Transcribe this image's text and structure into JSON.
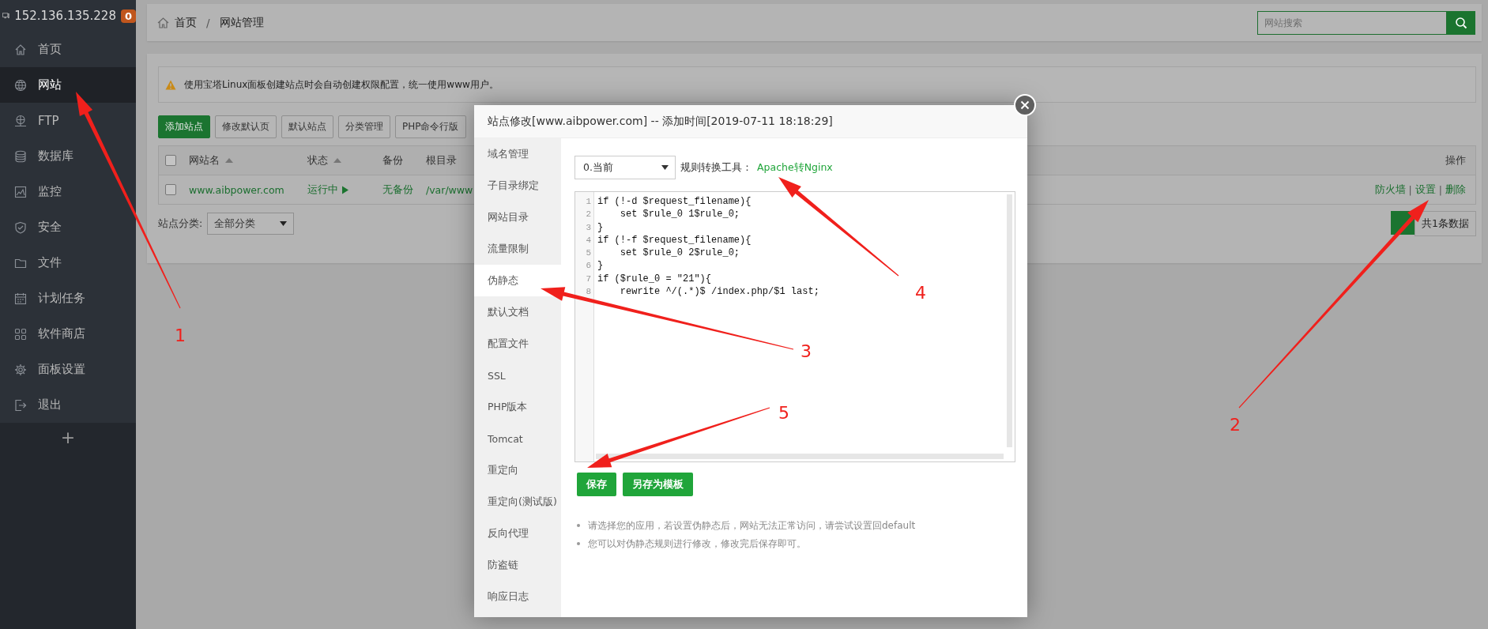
{
  "server": {
    "ip": "152.136.135.228",
    "badge": "0"
  },
  "sidebar": {
    "items": [
      {
        "label": "首页",
        "selected": false
      },
      {
        "label": "网站",
        "selected": true
      },
      {
        "label": "FTP",
        "selected": false
      },
      {
        "label": "数据库",
        "selected": false
      },
      {
        "label": "监控",
        "selected": false
      },
      {
        "label": "安全",
        "selected": false
      },
      {
        "label": "文件",
        "selected": false
      },
      {
        "label": "计划任务",
        "selected": false
      },
      {
        "label": "软件商店",
        "selected": false
      },
      {
        "label": "面板设置",
        "selected": false
      },
      {
        "label": "退出",
        "selected": false
      }
    ],
    "add": "+"
  },
  "breadcrumb": [
    "首页",
    "网站管理"
  ],
  "breadcrumb_separator": "/",
  "search": {
    "placeholder": "网站搜索"
  },
  "alert": "使用宝塔Linux面板创建站点时会自动创建权限配置，统一使用www用户。",
  "toolbar": [
    {
      "label": "添加站点",
      "kind": "primary"
    },
    {
      "label": "修改默认页",
      "kind": "default"
    },
    {
      "label": "默认站点",
      "kind": "default"
    },
    {
      "label": "分类管理",
      "kind": "default"
    },
    {
      "label": "PHP命令行版",
      "kind": "default"
    }
  ],
  "table": {
    "header_checked": false,
    "columns": [
      {
        "label": "网站名",
        "sortable": true
      },
      {
        "label": "状态",
        "sortable": true
      },
      {
        "label": "备份",
        "sortable": false
      },
      {
        "label": "根目录",
        "sortable": false
      },
      {
        "label": "操作",
        "sortable": false
      }
    ],
    "rows": [
      {
        "checked": false,
        "name": "www.aibpower.com",
        "status": "运行中",
        "backup": "无备份",
        "path": "/var/www",
        "actions": [
          "防火墙",
          "设置",
          "删除"
        ],
        "action_separators": [
          "|",
          "|"
        ]
      }
    ]
  },
  "category": {
    "label": "站点分类:",
    "value": "全部分类"
  },
  "pagination": {
    "total": "共1条数据"
  },
  "modal": {
    "title": "站点修改[www.aibpower.com] -- 添加时间[2019-07-11 18:18:29]",
    "tabs": [
      {
        "label": "域名管理",
        "selected": false
      },
      {
        "label": "子目录绑定",
        "selected": false
      },
      {
        "label": "网站目录",
        "selected": false
      },
      {
        "label": "流量限制",
        "selected": false
      },
      {
        "label": "伪静态",
        "selected": true
      },
      {
        "label": "默认文档",
        "selected": false
      },
      {
        "label": "配置文件",
        "selected": false
      },
      {
        "label": "SSL",
        "selected": false
      },
      {
        "label": "PHP版本",
        "selected": false
      },
      {
        "label": "Tomcat",
        "selected": false
      },
      {
        "label": "重定向",
        "selected": false
      },
      {
        "label": "重定向(测试版)",
        "selected": false
      },
      {
        "label": "反向代理",
        "selected": false
      },
      {
        "label": "防盗链",
        "selected": false
      },
      {
        "label": "响应日志",
        "selected": false
      }
    ],
    "rule_select": "0.当前",
    "tool_label": "规则转换工具：",
    "tool_link": "Apache转Nginx",
    "code": [
      {
        "n": "1",
        "text": "if (!-d $request_filename){"
      },
      {
        "n": "2",
        "text": "    set $rule_0 1$rule_0;"
      },
      {
        "n": "3",
        "text": "}"
      },
      {
        "n": "4",
        "text": "if (!-f $request_filename){"
      },
      {
        "n": "5",
        "text": "    set $rule_0 2$rule_0;"
      },
      {
        "n": "6",
        "text": "}"
      },
      {
        "n": "7",
        "text": "if ($rule_0 = \"21\"){"
      },
      {
        "n": "8",
        "text": "    rewrite ^/(.*)$ /index.php/$1 last;"
      }
    ],
    "buttons": [
      "保存",
      "另存为模板"
    ],
    "notes": [
      "请选择您的应用，若设置伪静态后，网站无法正常访问，请尝试设置回default",
      "您可以对伪静态规则进行修改，修改完后保存即可。"
    ]
  },
  "annotations": [
    {
      "label": "1"
    },
    {
      "label": "2"
    },
    {
      "label": "3"
    },
    {
      "label": "4"
    },
    {
      "label": "5"
    }
  ]
}
